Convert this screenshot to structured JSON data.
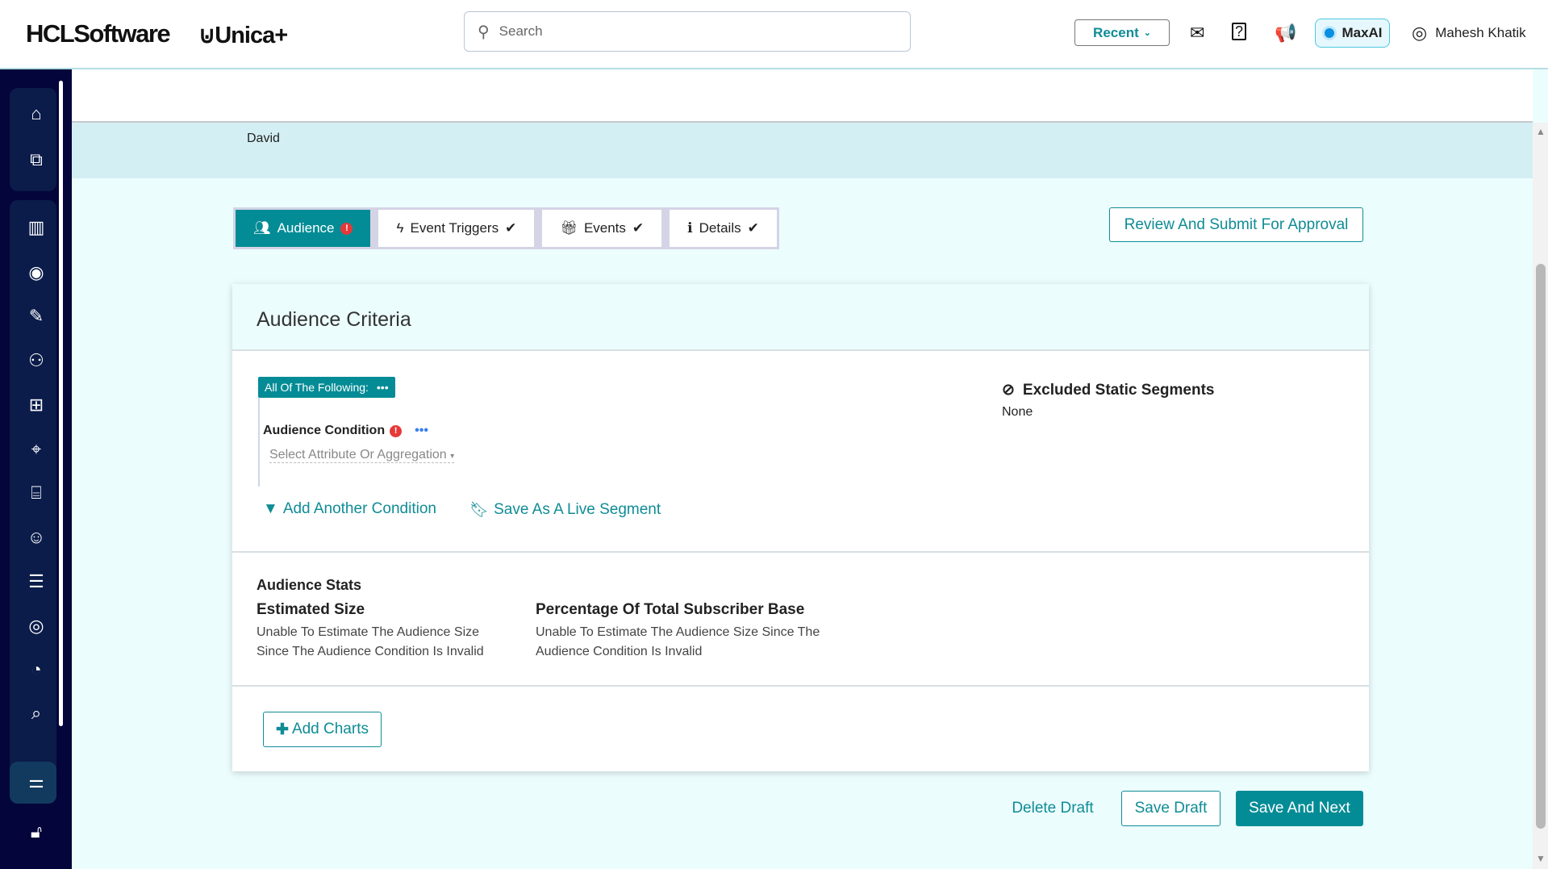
{
  "header": {
    "brand": "HCLSoftware",
    "product": "Unica+",
    "search_placeholder": "Search",
    "recent_label": "Recent",
    "maxai_label": "MaxAI",
    "user_name": "Mahesh Khatik"
  },
  "sidebar": {
    "items": [
      "home",
      "favorites",
      "analytics",
      "broadcast",
      "content-editor",
      "audience",
      "hierarchy",
      "offers",
      "bank",
      "bot",
      "settings-list",
      "targeting",
      "engagement",
      "insights"
    ],
    "bottom": [
      "filters",
      "unlock"
    ]
  },
  "page": {
    "name": "David"
  },
  "stepper": [
    {
      "label": "Audience",
      "state": "error"
    },
    {
      "label": "Event Triggers",
      "state": "done"
    },
    {
      "label": "Events",
      "state": "done"
    },
    {
      "label": "Details",
      "state": "done"
    }
  ],
  "review_label": "Review And Submit For Approval",
  "card": {
    "title": "Audience Criteria",
    "group_label": "All Of The Following:",
    "condition_label": "Audience Condition",
    "select_placeholder": "Select Attribute Or Aggregation",
    "add_condition": "Add Another Condition",
    "save_segment": "Save As A Live Segment",
    "excluded_title": "Excluded Static Segments",
    "excluded_value": "None",
    "stats_title": "Audience Stats",
    "est_title": "Estimated Size",
    "est_text": "Unable To Estimate The Audience Size Since The Audience Condition Is Invalid",
    "pct_title": "Percentage Of Total Subscriber Base",
    "pct_text": "Unable To Estimate The Audience Size Since The Audience Condition Is Invalid",
    "add_charts": "Add Charts"
  },
  "footer": {
    "delete": "Delete Draft",
    "save_draft": "Save Draft",
    "save_next": "Save And Next"
  },
  "colors": {
    "accent": "#048c96",
    "sidebar": "#04053a",
    "error": "#e53939"
  }
}
